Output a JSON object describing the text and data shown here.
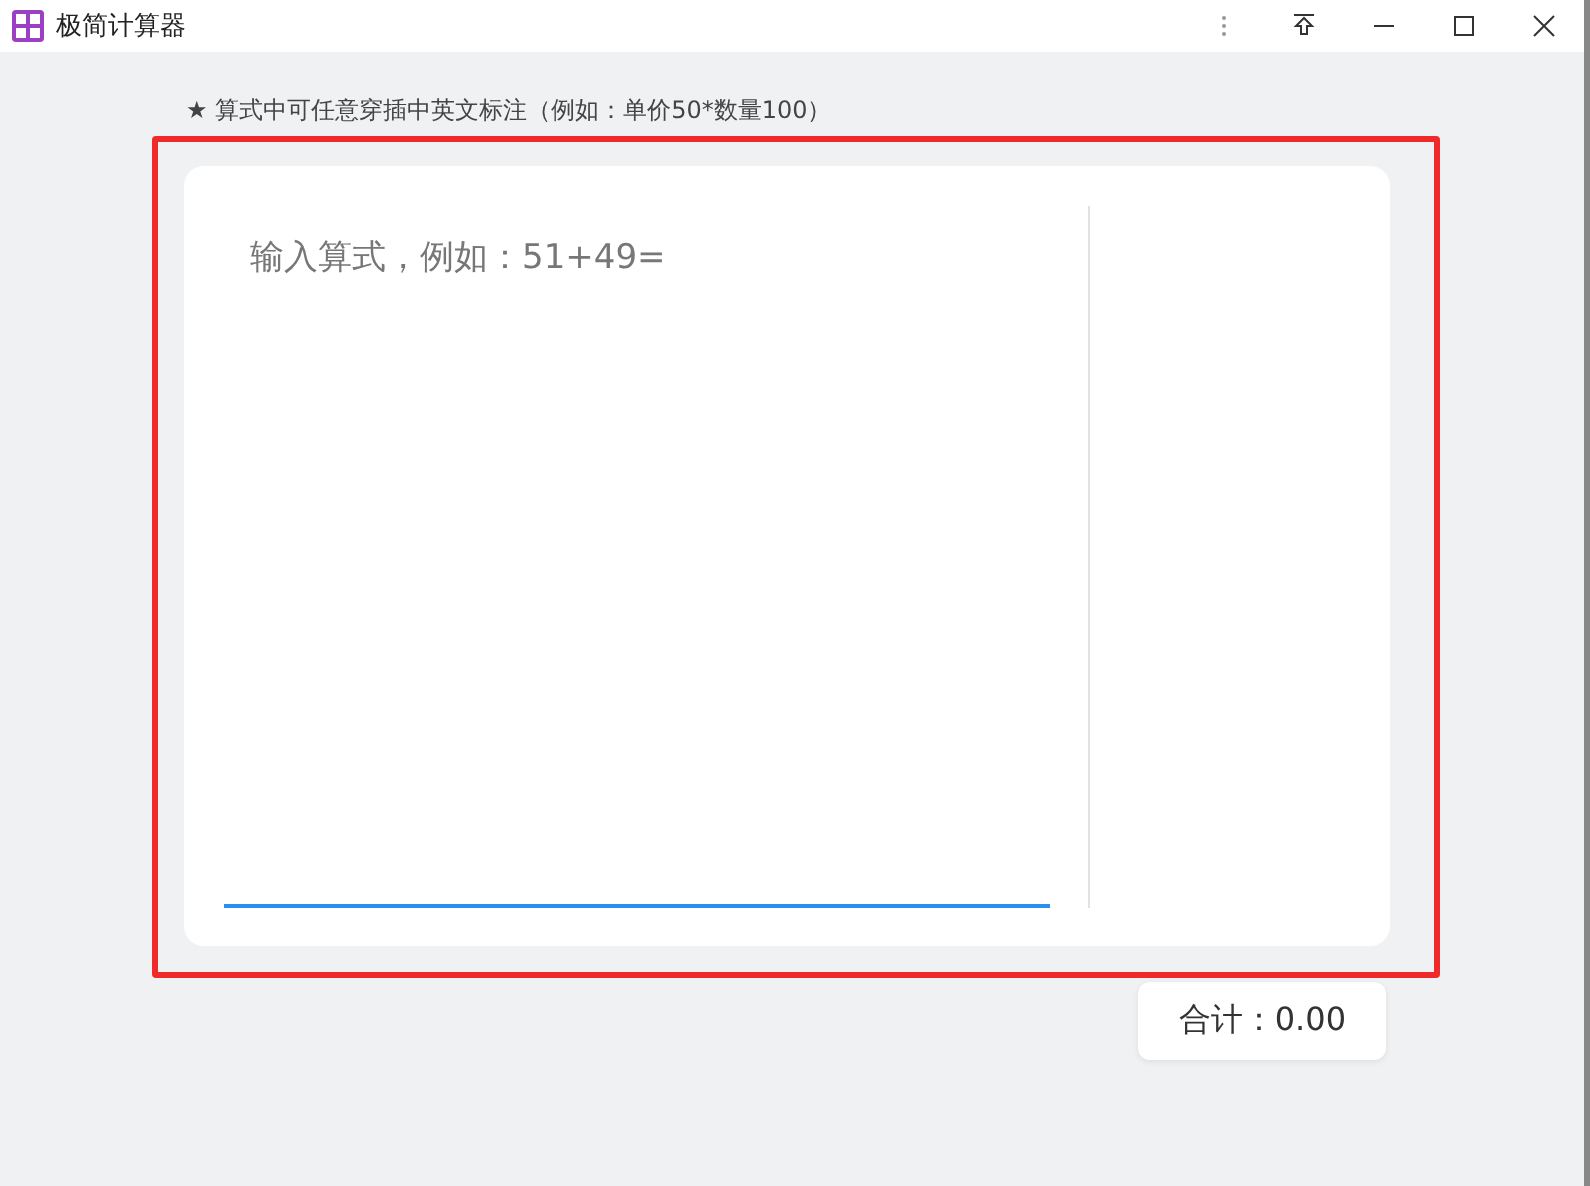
{
  "window": {
    "title": "极简计算器"
  },
  "hint": "★ 算式中可任意穿插中英文标注（例如：单价50*数量100）",
  "editor": {
    "placeholder": "输入算式，例如：51+49="
  },
  "total": "合计：0.00"
}
